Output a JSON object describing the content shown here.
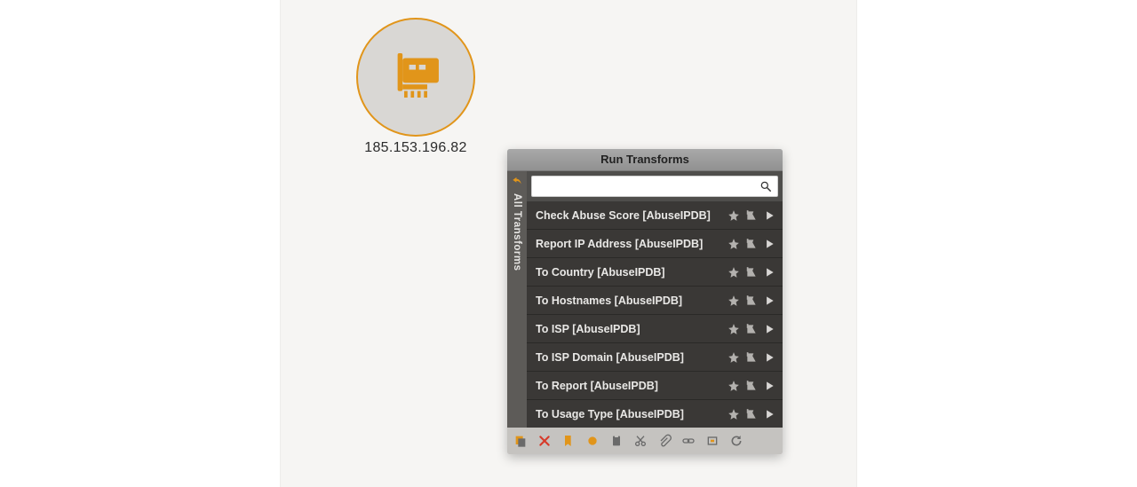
{
  "entity": {
    "ip": "185.153.196.82",
    "icon": "network-card-icon"
  },
  "panel": {
    "title": "Run Transforms",
    "side_tab": {
      "label": "All Transforms",
      "icon": "undo-arrow-icon"
    },
    "search": {
      "value": "",
      "placeholder": ""
    },
    "transforms": [
      {
        "label": "Check Abuse Score [AbuseIPDB]"
      },
      {
        "label": "Report IP Address [AbuseIPDB]"
      },
      {
        "label": "To Country [AbuseIPDB]"
      },
      {
        "label": "To Hostnames [AbuseIPDB]"
      },
      {
        "label": "To ISP [AbuseIPDB]"
      },
      {
        "label": "To ISP Domain [AbuseIPDB]"
      },
      {
        "label": "To Report [AbuseIPDB]"
      },
      {
        "label": "To Usage Type [AbuseIPDB]"
      }
    ],
    "toolbar": {
      "icons": [
        "copy-to-new-graph-icon",
        "delete-icon",
        "bookmark-icon",
        "circle-icon",
        "paste-icon",
        "cut-icon",
        "attachment-icon",
        "link-icon",
        "select-parents-icon",
        "refresh-icon"
      ]
    }
  }
}
